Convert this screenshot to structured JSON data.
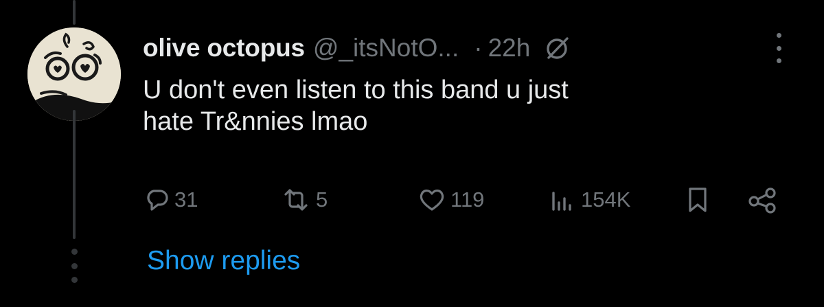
{
  "tweet": {
    "display_name": "olive octopus",
    "handle": "@_itsNotO...",
    "separator": "·",
    "time": "22h",
    "text_lines": [
      "U don't even listen to this band u just",
      "hate Tr&nnies lmao"
    ]
  },
  "actions": {
    "reply_count": "31",
    "repost_count": "5",
    "like_count": "119",
    "view_count": "154K"
  },
  "show_replies_label": "Show replies",
  "icons": {
    "avatar": "avatar-doodle-icon",
    "grok": "grok-icon",
    "more": "more-vertical-icon",
    "reply": "reply-bubble-icon",
    "repost": "repost-icon",
    "like": "heart-icon",
    "views": "views-bar-chart-icon",
    "bookmark": "bookmark-icon",
    "share": "share-icon"
  },
  "colors": {
    "background": "#000000",
    "text_primary": "#e7e9ea",
    "text_secondary": "#71767b",
    "link": "#1d9bf0",
    "thread_line": "#333639"
  }
}
